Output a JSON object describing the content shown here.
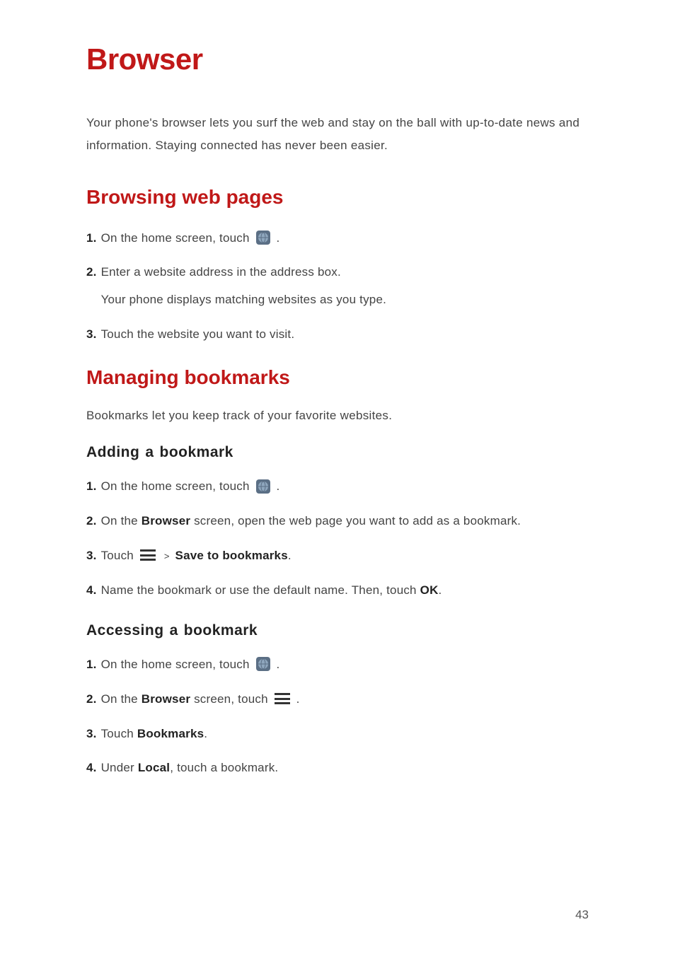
{
  "title": "Browser",
  "intro": "Your phone's browser lets you surf the web and stay on the ball with up-to-date news and information. Staying connected has never been easier.",
  "section1": {
    "heading": "Browsing web pages",
    "steps": {
      "s1_num": "1.",
      "s1_text": "On the home screen, touch ",
      "s1_after": ".",
      "s2_num": "2.",
      "s2_text": "Enter a website address in the address box.",
      "s2_sub": "Your phone displays matching websites as you type.",
      "s3_num": "3.",
      "s3_text": "Touch the website you want to visit."
    }
  },
  "section2": {
    "heading": "Managing bookmarks",
    "intro": "Bookmarks let you keep track of your favorite websites.",
    "sub1": {
      "heading_a": "Adding",
      "heading_b": "a",
      "heading_c": "bookmark",
      "s1_num": "1.",
      "s1_text": "On the home screen, touch ",
      "s1_after": ".",
      "s2_num": "2.",
      "s2_before": "On the ",
      "s2_bold": "Browser",
      "s2_after": " screen, open the web page you want to add as a bookmark.",
      "s3_num": "3.",
      "s3_before": "Touch ",
      "s3_bold": "Save to bookmarks",
      "s3_after": ".",
      "s3_gt": ">",
      "s4_num": "4.",
      "s4_before": "Name the bookmark or use the default name. Then, touch ",
      "s4_bold": "OK",
      "s4_after": "."
    },
    "sub2": {
      "heading_a": "Accessing",
      "heading_b": "a",
      "heading_c": "bookmark",
      "s1_num": "1.",
      "s1_text": "On the home screen, touch ",
      "s1_after": ".",
      "s2_num": "2.",
      "s2_before": "On the ",
      "s2_bold": "Browser",
      "s2_after_a": " screen, touch ",
      "s2_after_b": ".",
      "s3_num": "3.",
      "s3_before": "Touch ",
      "s3_bold": "Bookmarks",
      "s3_after": ".",
      "s4_num": "4.",
      "s4_before": "Under ",
      "s4_bold": "Local",
      "s4_after": ", touch a bookmark."
    }
  },
  "page_number": "43",
  "colors": {
    "accent": "#c01818"
  }
}
